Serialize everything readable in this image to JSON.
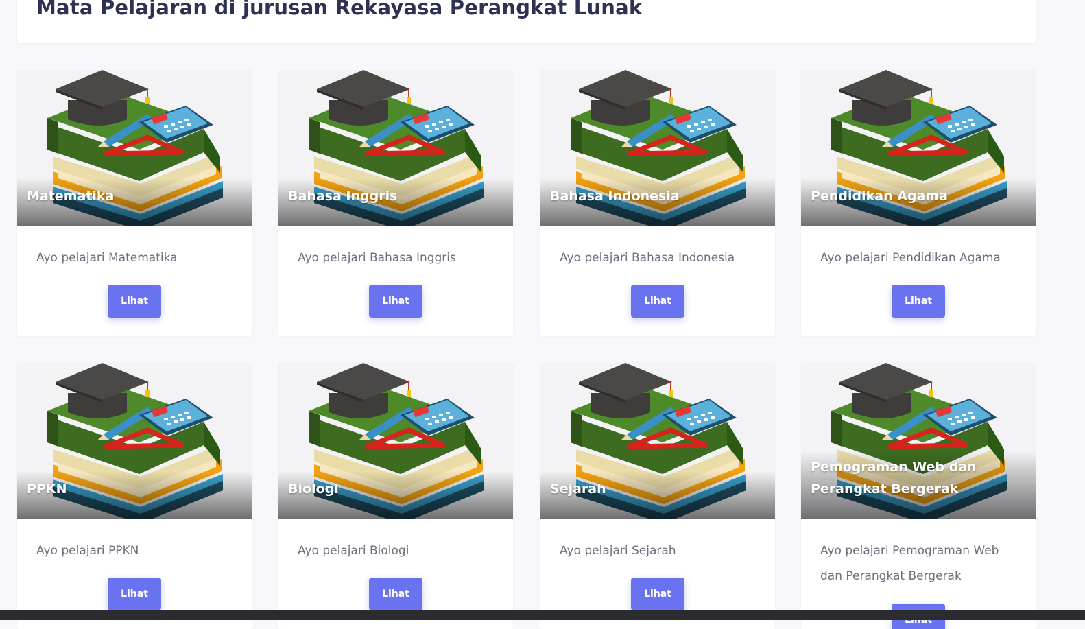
{
  "header": {
    "title": "Mata Pelajaran di jurusan Rekayasa Perangkat Lunak"
  },
  "courses": [
    {
      "title": "Matematika",
      "description": "Ayo pelajari Matematika",
      "button": "Lihat"
    },
    {
      "title": "Bahasa Inggris",
      "description": "Ayo pelajari Bahasa Inggris",
      "button": "Lihat"
    },
    {
      "title": "Bahasa Indonesia",
      "description": "Ayo pelajari Bahasa Indonesia",
      "button": "Lihat"
    },
    {
      "title": "Pendidikan Agama",
      "description": "Ayo pelajari Pendidikan Agama",
      "button": "Lihat"
    },
    {
      "title": "PPKN",
      "description": "Ayo pelajari PPKN",
      "button": "Lihat"
    },
    {
      "title": "Biologi",
      "description": "Ayo pelajari Biologi",
      "button": "Lihat"
    },
    {
      "title": "Sejarah",
      "description": "Ayo pelajari Sejarah",
      "button": "Lihat"
    },
    {
      "title": "Pemograman Web dan Perangkat Bergerak",
      "description": "Ayo pelajari Pemograman Web dan Perangkat Bergerak",
      "button": "Lihat"
    }
  ],
  "colors": {
    "accent": "#6a73ef",
    "title_text": "#2d3152",
    "body_text": "#6c707d",
    "page_background": "#f8f8fc"
  }
}
